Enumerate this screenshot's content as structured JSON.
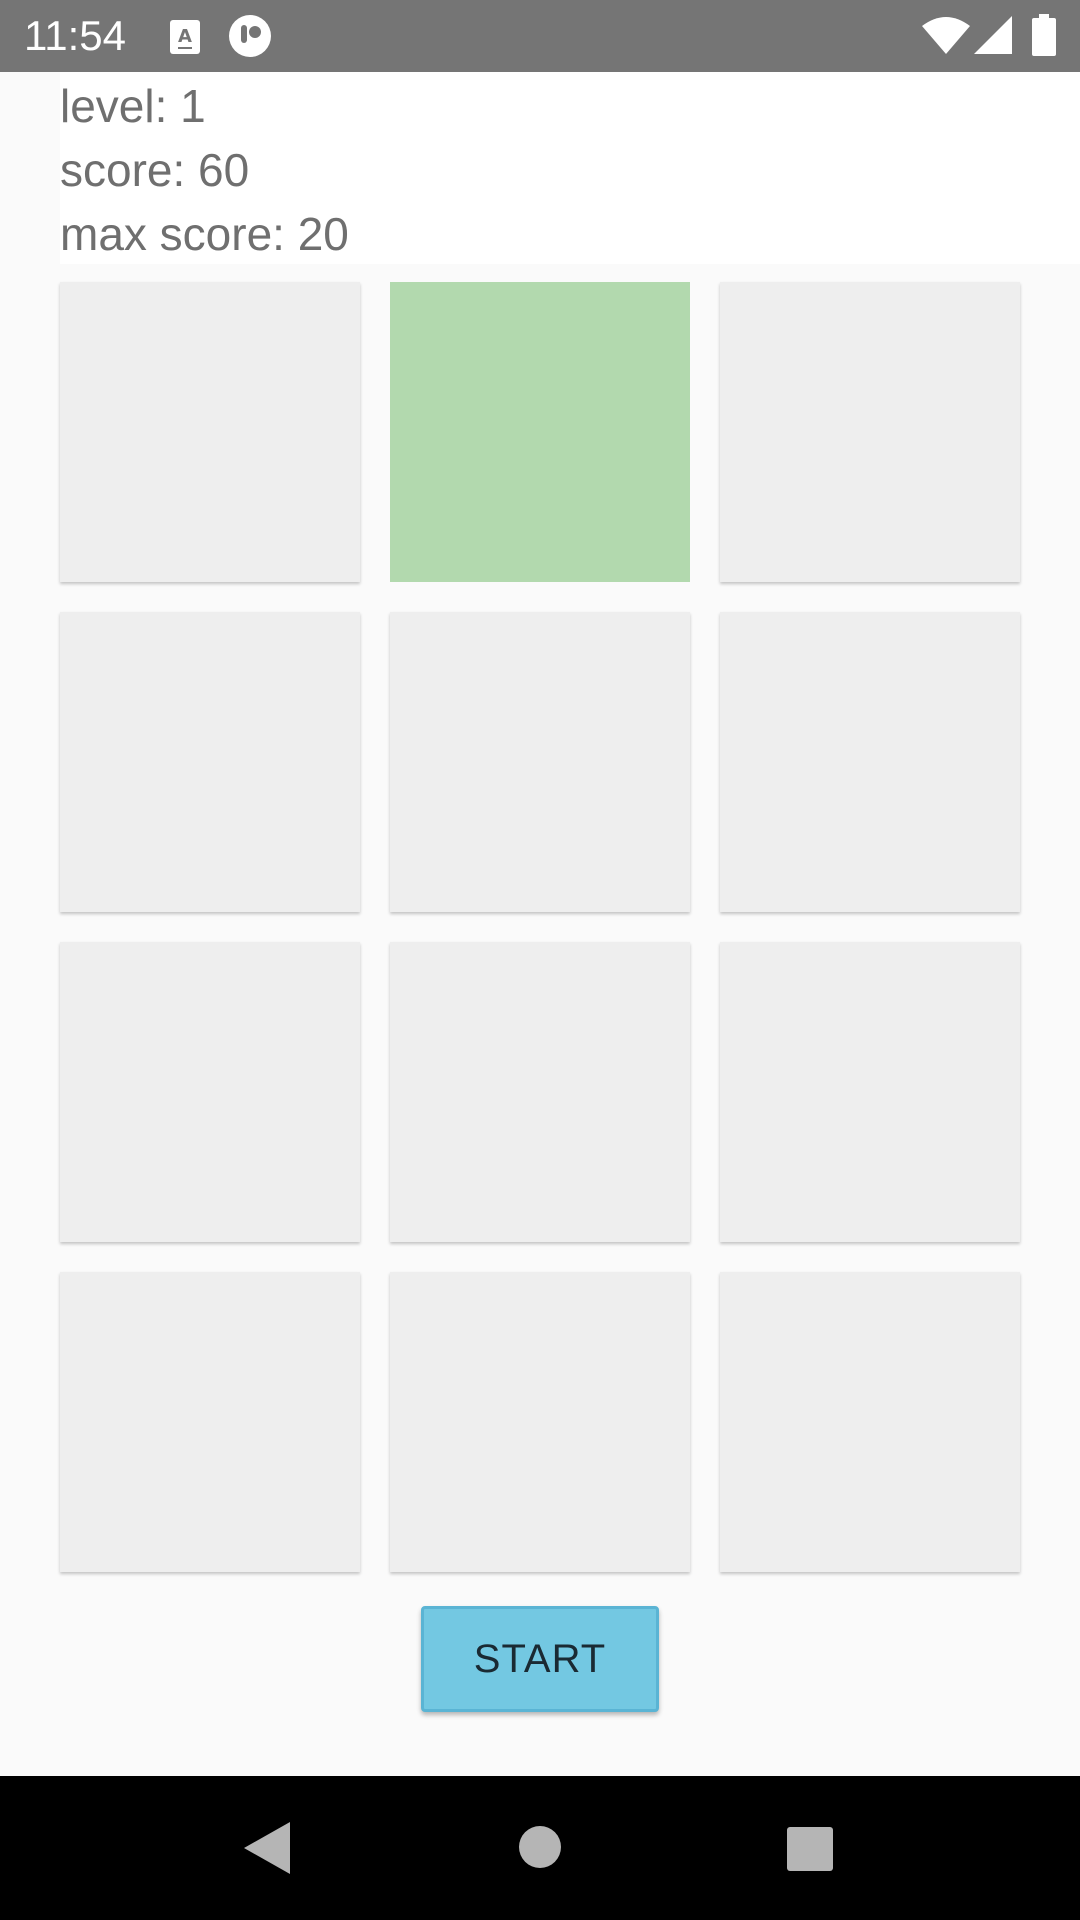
{
  "status_bar": {
    "time": "11:54",
    "left_icons": [
      "font-download-icon",
      "timer-app-icon"
    ],
    "right_icons": [
      "wifi-icon",
      "cellular-signal-icon",
      "battery-icon"
    ],
    "background": "#757575"
  },
  "info": {
    "level": "level: 1",
    "score": "score: 60",
    "max_score": "max score: 20"
  },
  "grid": {
    "rows": 4,
    "columns": 3,
    "active_tile": "row 1, column 2",
    "tile_color": "#eeeeee",
    "active_color": "#b2d9ae"
  },
  "start_button": {
    "label": "START",
    "color": "#73c8e2"
  },
  "nav_bar": {
    "icons": [
      "back-icon",
      "home-icon",
      "recents-icon"
    ]
  }
}
